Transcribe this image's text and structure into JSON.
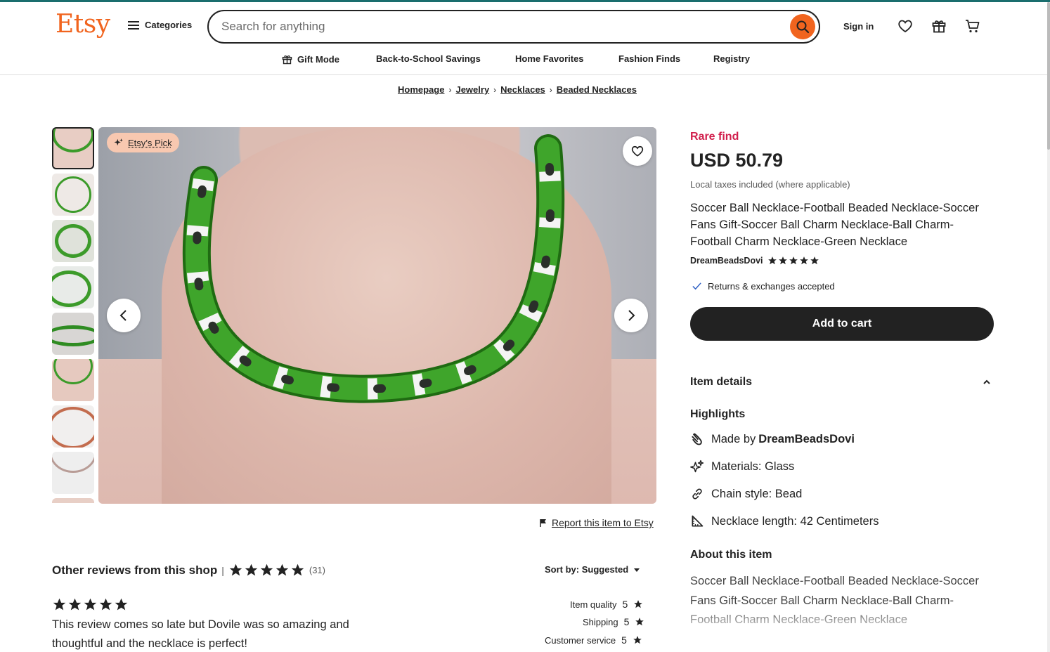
{
  "header": {
    "logo": "Etsy",
    "categories_label": "Categories",
    "search_placeholder": "Search for anything",
    "sign_in": "Sign in"
  },
  "subnav": [
    {
      "label": "Gift Mode",
      "icon": "gift-icon"
    },
    {
      "label": "Back-to-School Savings"
    },
    {
      "label": "Home Favorites"
    },
    {
      "label": "Fashion Finds"
    },
    {
      "label": "Registry"
    }
  ],
  "breadcrumb": [
    "Homepage",
    "Jewelry",
    "Necklaces",
    "Beaded Necklaces"
  ],
  "gallery": {
    "badge": "Etsy’s Pick",
    "thumbnail_count": 9,
    "active_index": 0
  },
  "report_link": "Report this item to Etsy",
  "product": {
    "rare": "Rare find",
    "price": "USD 50.79",
    "taxes": "Local taxes included (where applicable)",
    "title": "Soccer Ball Necklace-Football Beaded Necklace-Soccer Fans Gift-Soccer Ball Charm Necklace-Ball Charm-Football Charm Necklace-Green Necklace",
    "shop": "DreamBeadsDovi",
    "shop_rating": 5,
    "returns": "Returns & exchanges accepted",
    "add_to_cart": "Add to cart"
  },
  "details": {
    "section_title": "Item details",
    "highlights_title": "Highlights",
    "made_by_prefix": "Made by",
    "made_by_shop": "DreamBeadsDovi",
    "materials": "Materials: Glass",
    "chain_style": "Chain style: Bead",
    "necklace_length": "Necklace length: 42 Centimeters",
    "about_title": "About this item",
    "about_text": "Soccer Ball Necklace-Football Beaded Necklace-Soccer Fans Gift-Soccer Ball Charm Necklace-Ball Charm-Football Charm Necklace-Green Necklace"
  },
  "reviews": {
    "title": "Other reviews from this shop",
    "separator": "|",
    "count": "(31)",
    "sort": "Sort by: Suggested",
    "first_review": {
      "rating": 5,
      "text": "This review comes so late but Dovile was so amazing and thoughtful and the necklace is perfect!",
      "item_quality_label": "Item quality",
      "item_quality": "5",
      "shipping_label": "Shipping",
      "shipping": "5",
      "customer_service_label": "Customer service",
      "customer_service": "5"
    }
  },
  "colors": {
    "brand": "#F1641E",
    "rare": "#D11F4C",
    "button": "#222222"
  }
}
